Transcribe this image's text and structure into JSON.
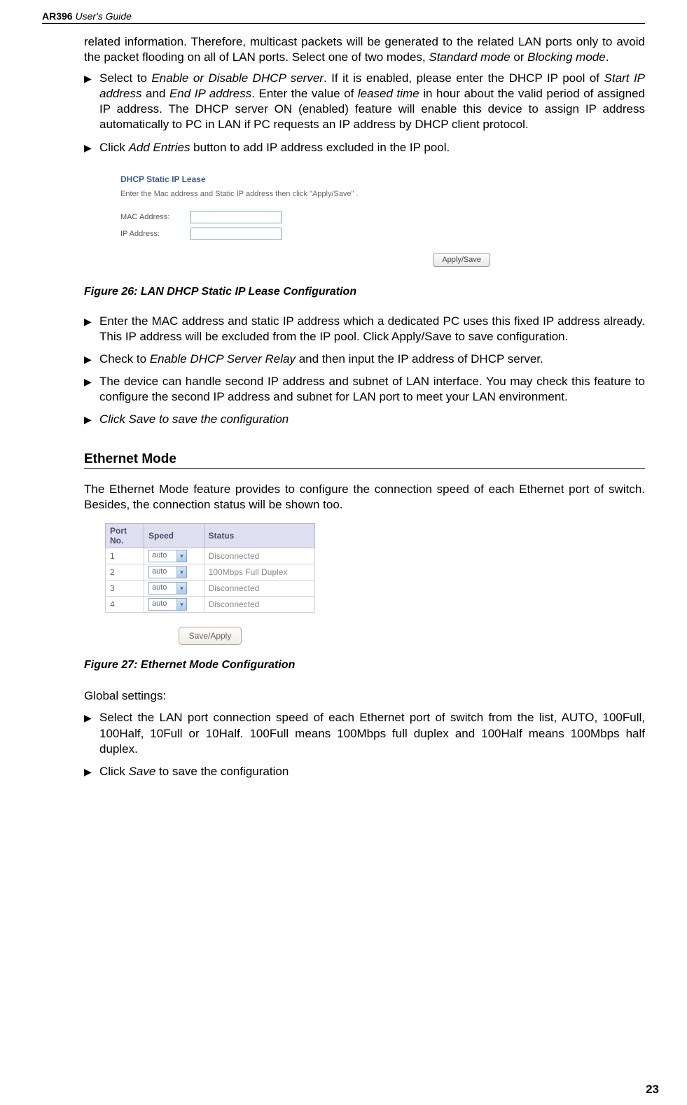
{
  "header": {
    "model": "AR396",
    "guide": " User's Guide"
  },
  "intro_para": "related information. Therefore, multicast packets will be generated to the related LAN ports only to avoid the packet flooding on all of LAN ports. Select one of two modes, ",
  "intro_italic1": "Standard mode",
  "intro_or": " or ",
  "intro_italic2": "Blocking mode",
  "intro_dot": ".",
  "b1_a": "Select to ",
  "b1_i": "Enable or Disable DHCP server",
  "b1_b": ". If it is enabled, please enter the DHCP IP pool of ",
  "b1_i2": "Start IP address",
  "b1_c": " and ",
  "b1_i3": "End IP address",
  "b1_d": ". Enter the value of ",
  "b1_i4": "leased time",
  "b1_e": " in hour about the valid period of assigned IP address. The DHCP server ON (enabled) feature will enable this device to assign IP address automatically to PC in LAN if PC requests an IP address by DHCP client protocol.",
  "b2_a": "Click ",
  "b2_i": "Add Entries",
  "b2_b": " button to add IP address excluded in the IP pool.",
  "dhcp": {
    "title": "DHCP Static IP Lease",
    "note": "Enter the Mac address and Static IP address then click \"Apply/Save\" .",
    "mac_label": "MAC Address:",
    "ip_label": "IP Address:",
    "button": "Apply/Save"
  },
  "fig26": "Figure 26: LAN DHCP Static IP Lease Configuration",
  "b3": "Enter the MAC address and static IP address which a dedicated PC uses this fixed IP address already. This IP address will be excluded from the IP pool. Click Apply/Save to save configuration.",
  "b4_a": "Check to ",
  "b4_i": "Enable DHCP Server Relay",
  "b4_b": " and then input the IP address of DHCP server.",
  "b5": "The device can handle second IP address and subnet of LAN interface. You may check this feature to configure the second IP address and subnet for LAN port to meet your LAN environment.",
  "b6": "Click Save to save the configuration",
  "section_eth": "Ethernet Mode",
  "eth_intro": "The Ethernet Mode feature provides to configure the connection speed of each Ethernet port of switch. Besides, the connection status will be shown too.",
  "eth_table": {
    "h1": "Port No.",
    "h2": "Speed",
    "h3": "Status",
    "rows": [
      {
        "port": "1",
        "speed": "auto",
        "status": "Disconnected"
      },
      {
        "port": "2",
        "speed": "auto",
        "status": "100Mbps Full Duplex"
      },
      {
        "port": "3",
        "speed": "auto",
        "status": "Disconnected"
      },
      {
        "port": "4",
        "speed": "auto",
        "status": "Disconnected"
      }
    ],
    "button": "Save/Apply"
  },
  "fig27": "Figure 27: Ethernet Mode Configuration",
  "global_label": "Global settings:",
  "gb1": "Select the LAN port connection speed of each Ethernet port of switch from the list, AUTO, 100Full, 100Half, 10Full or 10Half. 100Full means 100Mbps full duplex and 100Half means 100Mbps half duplex.",
  "gb2_a": "Click ",
  "gb2_i": "Save",
  "gb2_b": " to save the configuration",
  "page_num": "23",
  "chart_data": {
    "type": "table",
    "title": "Ethernet Mode",
    "columns": [
      "Port No.",
      "Speed",
      "Status"
    ],
    "rows": [
      [
        1,
        "auto",
        "Disconnected"
      ],
      [
        2,
        "auto",
        "100Mbps Full Duplex"
      ],
      [
        3,
        "auto",
        "Disconnected"
      ],
      [
        4,
        "auto",
        "Disconnected"
      ]
    ]
  }
}
